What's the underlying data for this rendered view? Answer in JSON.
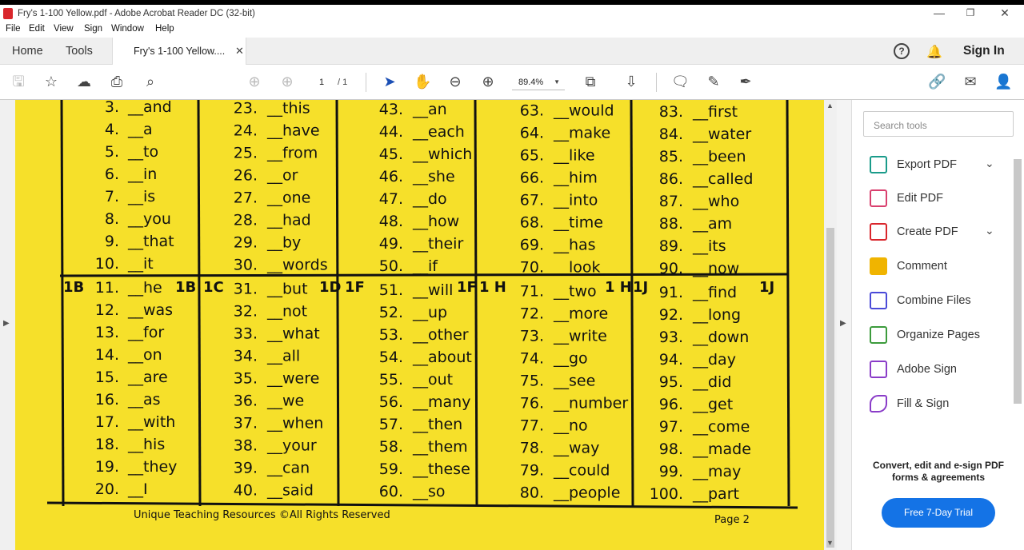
{
  "window": {
    "title": "Fry's 1-100  Yellow.pdf - Adobe Acrobat Reader DC (32-bit)"
  },
  "menu": [
    "File",
    "Edit",
    "View",
    "Sign",
    "Window",
    "Help"
  ],
  "tabs": {
    "home": "Home",
    "tools": "Tools",
    "doc": "Fry's 1-100  Yellow...."
  },
  "header": {
    "signin": "Sign In"
  },
  "toolbar": {
    "page_current": "1",
    "page_total": "/  1",
    "zoom": "89.4%"
  },
  "worksheet": {
    "columns": [
      {
        "words": [
          "3. __and",
          "4. __a",
          "5. __to",
          "6. __in",
          "7. __is",
          "8. __you",
          "9. __that",
          "10. __it",
          "11. __he",
          "12. __was",
          "13. __for",
          "14. __on",
          "15. __are",
          "16. __as",
          "17. __with",
          "18. __his",
          "19. __they",
          "20. __I"
        ],
        "hand": "1B",
        "hand2": "1B"
      },
      {
        "words": [
          "23. __this",
          "24. __have",
          "25. __from",
          "26. __or",
          "27. __one",
          "28. __had",
          "29. __by",
          "30. __words",
          "31. __but",
          "32. __not",
          "33. __what",
          "34. __all",
          "35. __were",
          "36. __we",
          "37. __when",
          "38. __your",
          "39. __can",
          "40. __said"
        ],
        "hand": "1C",
        "hand2": "1D"
      },
      {
        "words": [
          "43. __an",
          "44. __each",
          "45. __which",
          "46. __she",
          "47. __do",
          "48. __how",
          "49. __their",
          "50. __if",
          "51. __will",
          "52. __up",
          "53. __other",
          "54. __about",
          "55. __out",
          "56. __many",
          "57. __then",
          "58. __them",
          "59. __these",
          "60. __so"
        ],
        "hand": "1F",
        "hand2": "1F"
      },
      {
        "words": [
          "63. __would",
          "64. __make",
          "65. __like",
          "66. __him",
          "67. __into",
          "68. __time",
          "69. __has",
          "70. __look",
          "71. __two",
          "72. __more",
          "73. __write",
          "74. __go",
          "75. __see",
          "76. __number",
          "77. __no",
          "78. __way",
          "79. __could",
          "80. __people"
        ],
        "hand": "1 H",
        "hand2": "1 H"
      },
      {
        "words": [
          "83. __first",
          "84. __water",
          "85. __been",
          "86. __called",
          "87. __who",
          "88. __am",
          "89. __its",
          "90. __now",
          "91. __find",
          "92. __long",
          "93. __down",
          "94. __day",
          "95. __did",
          "96. __get",
          "97. __come",
          "98. __made",
          "99. __may",
          "100. __part"
        ],
        "hand": "1J",
        "hand2": "1J"
      }
    ],
    "footer_left": "Unique Teaching Resources ©All Rights Reserved",
    "footer_right": "Page 2"
  },
  "panel": {
    "search_placeholder": "Search tools",
    "tools": [
      {
        "label": "Export PDF",
        "color": "#1a9b8a"
      },
      {
        "label": "Edit PDF",
        "color": "#d9406e"
      },
      {
        "label": "Create PDF",
        "color": "#d9262c"
      },
      {
        "label": "Comment",
        "color": "#f0b400"
      },
      {
        "label": "Combine Files",
        "color": "#4a4ad8"
      },
      {
        "label": "Organize Pages",
        "color": "#3c9b3c"
      },
      {
        "label": "Adobe Sign",
        "color": "#8a3cc8"
      },
      {
        "label": "Fill & Sign",
        "color": "#8a3cc8"
      }
    ],
    "promo": "Convert, edit and e-sign PDF forms & agreements",
    "trial": "Free 7-Day Trial"
  }
}
